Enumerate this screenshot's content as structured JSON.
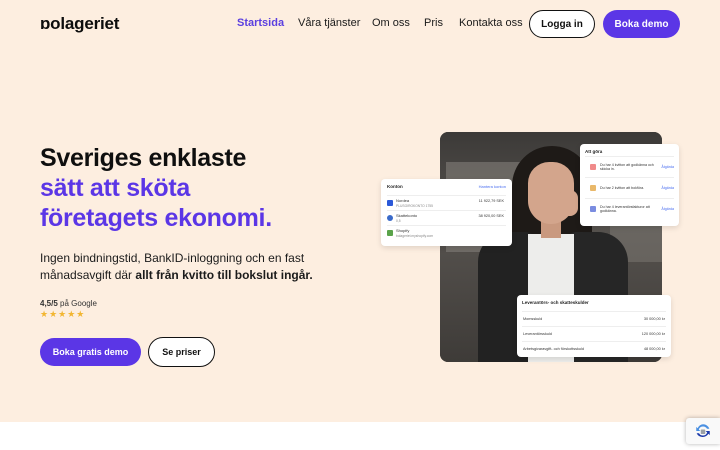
{
  "header": {
    "logo_text": "ɒolageriet",
    "nav": [
      "Startsida",
      "Våra tjänster",
      "Om oss",
      "Pris",
      "Kontakta oss"
    ],
    "login_label": "Logga in",
    "demo_label": "Boka demo"
  },
  "hero": {
    "headline_line1": "Sveriges enklaste",
    "headline_line2": "sätt att sköta",
    "headline_line3": "företagets ekonomi.",
    "lead_plain": "Ingen bindningstid, BankID-inloggning och en fast månadsavgift där ",
    "lead_bold": "allt från kvitto till bokslut ingår.",
    "rating_score": "4,5/5",
    "rating_source": "på Google",
    "stars": "★★★★★",
    "rating_value": 4.5,
    "cta_primary": "Boka gratis demo",
    "cta_secondary": "Se priser"
  },
  "konton": {
    "title": "Konton",
    "link": "Hantera konton",
    "rows": [
      {
        "name": "Nordea",
        "sub": "PLUSGIROKONTO 1755",
        "amount": "11 922,79 SEK"
      },
      {
        "name": "Skattekonto",
        "sub": "0,5",
        "amount": "38 920,00 SEK"
      },
      {
        "name": "Shopify",
        "sub": "bolageriet.myshopify.com",
        "amount": ""
      }
    ]
  },
  "atgora": {
    "title": "Att göra",
    "rows": [
      {
        "text": "Du har 4 kvitton att godkänna och skicka in.",
        "link": "Åtgärda"
      },
      {
        "text": "Du har 2 kvitton att bokföra.",
        "link": "Åtgärda"
      },
      {
        "text": "Du har 4 leverantörsfakturor att godkänna.",
        "link": "Åtgärda"
      }
    ]
  },
  "skulder": {
    "title": "Leverantörs- och skatteskulder",
    "rows": [
      {
        "label": "Momsskuld",
        "amount": "30 000,00 kr"
      },
      {
        "label": "Leverantörsskuld",
        "amount": "120 000,00 kr"
      },
      {
        "label": "Arbetsgivaravgift- och förskottsskuld",
        "amount": "48 000,00 kr"
      }
    ]
  },
  "colors": {
    "accent": "#5b36e6",
    "hero_bg": "#fdeee0",
    "star": "#f2b632"
  }
}
